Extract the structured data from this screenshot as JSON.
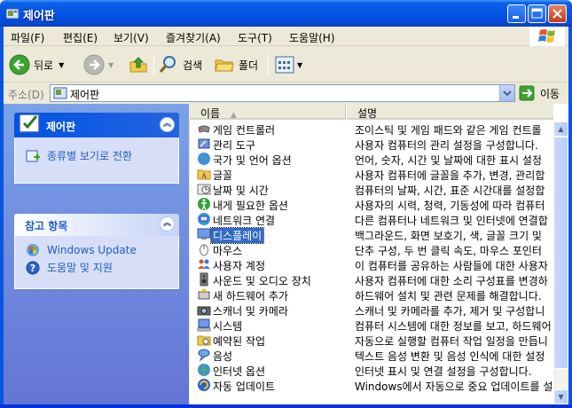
{
  "window": {
    "title": "제어판"
  },
  "menu": [
    "파일(F)",
    "편집(E)",
    "보기(V)",
    "즐겨찾기(A)",
    "도구(T)",
    "도움말(H)"
  ],
  "toolbar": {
    "back": "뒤로",
    "search": "검색",
    "folders": "폴더"
  },
  "address": {
    "label": "주소(D)",
    "value": "제어판",
    "go": "이동"
  },
  "taskpane": {
    "panel_title": "제어판",
    "switch_view": "종류별 보기로 전환",
    "see_also_title": "참고 항목",
    "links": [
      "Windows Update",
      "도움말 및 지원"
    ]
  },
  "list": {
    "columns": [
      "이름",
      "설명"
    ],
    "rows": [
      {
        "name": "게임 컨트롤러",
        "desc": "조이스틱 및 게임 패드와 같은 게임 컨트롤",
        "icon": "gamepad-icon"
      },
      {
        "name": "관리 도구",
        "desc": "사용자 컴퓨터의 관리 설정을 구성합니다.",
        "icon": "admin-tools-icon"
      },
      {
        "name": "국가 및 언어 옵션",
        "desc": "언어, 숫자, 시간 및 날짜에 대한 표시 설정",
        "icon": "globe-icon"
      },
      {
        "name": "글꼴",
        "desc": "사용자 컴퓨터에 글꼴을 추가, 변경, 관리합",
        "icon": "fonts-folder-icon"
      },
      {
        "name": "날짜 및 시간",
        "desc": "컴퓨터의 날짜, 시간, 표준 시간대를 설정합",
        "icon": "clock-icon"
      },
      {
        "name": "내게 필요한 옵션",
        "desc": "사용자의 시력, 청력, 기동성에 따라 컴퓨터",
        "icon": "accessibility-icon"
      },
      {
        "name": "네트워크 연결",
        "desc": "다른 컴퓨터나 네트워크 및 인터넷에 연결합",
        "icon": "network-icon"
      },
      {
        "name": "디스플레이",
        "desc": "백그라운드, 화면 보호기, 색, 글꼴 크기 및",
        "icon": "display-icon",
        "selected": true
      },
      {
        "name": "마우스",
        "desc": "단추 구성, 두 번 클릭 속도, 마우스 포인터",
        "icon": "mouse-icon"
      },
      {
        "name": "사용자 계정",
        "desc": "이 컴퓨터를 공유하는 사람들에 대한 사용자",
        "icon": "users-icon"
      },
      {
        "name": "사운드 및 오디오 장치",
        "desc": "사용자 컴퓨터에 대한 소리 구성표를 변경하",
        "icon": "speaker-icon"
      },
      {
        "name": "새 하드웨어 추가",
        "desc": "하드웨어 설치 및 관련 문제를 해결합니다.",
        "icon": "hardware-icon"
      },
      {
        "name": "스캐너 및 카메라",
        "desc": "스캐너 및 카메라를 추가, 제거 및 구성합니",
        "icon": "camera-icon"
      },
      {
        "name": "시스템",
        "desc": "컴퓨터 시스템에 대한 정보를 보고, 하드웨어",
        "icon": "system-icon"
      },
      {
        "name": "예약된 작업",
        "desc": "자동으로 실행할 컴퓨터 작업 일정을 만듭니",
        "icon": "tasks-folder-icon"
      },
      {
        "name": "음성",
        "desc": "텍스트 음성 변환 및 음성 인식에 대한 설정",
        "icon": "speech-icon"
      },
      {
        "name": "인터넷 옵션",
        "desc": "인터넷 표시 및 연결 설정을 구성합니다.",
        "icon": "internet-icon"
      },
      {
        "name": "자동 업데이트",
        "desc": "Windows에서 자동으로 중요 업데이트를 설치",
        "icon": "update-icon"
      }
    ]
  }
}
